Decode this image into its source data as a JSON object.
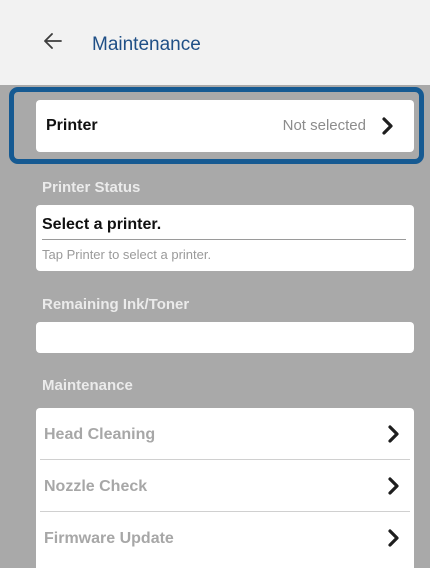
{
  "header": {
    "title": "Maintenance",
    "back_icon": "arrow-left-icon"
  },
  "printer": {
    "label": "Printer",
    "value": "Not selected",
    "chevron_icon": "chevron-right-icon"
  },
  "printer_status": {
    "heading": "Printer Status",
    "title": "Select a printer.",
    "subtitle": "Tap Printer to select a printer."
  },
  "ink": {
    "heading": "Remaining Ink/Toner"
  },
  "maintenance": {
    "heading": "Maintenance",
    "items": [
      {
        "label": "Head Cleaning"
      },
      {
        "label": "Nozzle Check"
      },
      {
        "label": "Firmware Update"
      }
    ]
  },
  "colors": {
    "header_bg": "#f2f2f2",
    "title": "#1f4f86",
    "highlight": "#165a92",
    "screen_bg": "#a9a9a9"
  }
}
